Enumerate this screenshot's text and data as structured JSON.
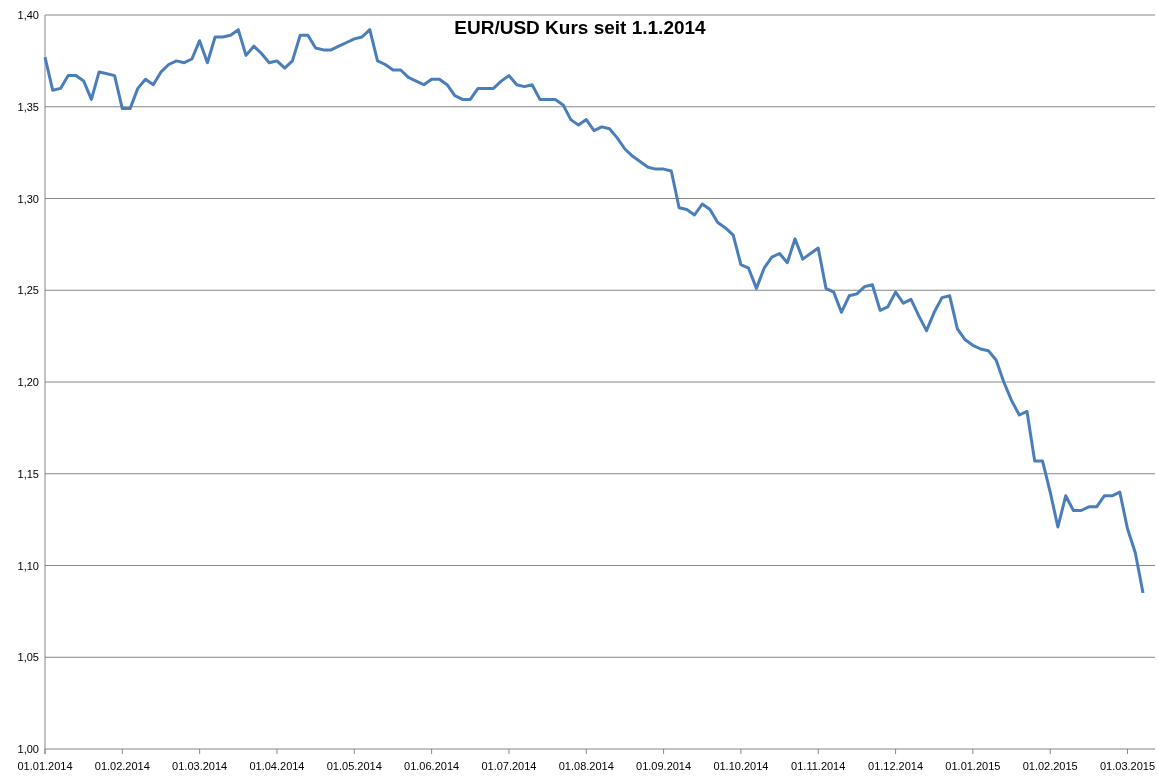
{
  "chart": {
    "chart_data": {
      "type": "line",
      "title": "EUR/USD Kurs seit 1.1.2014",
      "categories": [
        "01.01.2014",
        null,
        null,
        null,
        null,
        null,
        null,
        null,
        null,
        null,
        "01.02.2014",
        null,
        null,
        null,
        null,
        null,
        null,
        null,
        null,
        null,
        "01.03.2014",
        null,
        null,
        null,
        null,
        null,
        null,
        null,
        null,
        null,
        "01.04.2014",
        null,
        null,
        null,
        null,
        null,
        null,
        null,
        null,
        null,
        "01.05.2014",
        null,
        null,
        null,
        null,
        null,
        null,
        null,
        null,
        null,
        "01.06.2014",
        null,
        null,
        null,
        null,
        null,
        null,
        null,
        null,
        null,
        "01.07.2014",
        null,
        null,
        null,
        null,
        null,
        null,
        null,
        null,
        null,
        "01.08.2014",
        null,
        null,
        null,
        null,
        null,
        null,
        null,
        null,
        null,
        "01.09.2014",
        null,
        null,
        null,
        null,
        null,
        null,
        null,
        null,
        null,
        "01.10.2014",
        null,
        null,
        null,
        null,
        null,
        null,
        null,
        null,
        null,
        "01.11.2014",
        null,
        null,
        null,
        null,
        null,
        null,
        null,
        null,
        null,
        "01.12.2014",
        null,
        null,
        null,
        null,
        null,
        null,
        null,
        null,
        null,
        "01.01.2015",
        null,
        null,
        null,
        null,
        null,
        null,
        null,
        null,
        null,
        "01.02.2015",
        null,
        null,
        null,
        null,
        null,
        null,
        null,
        null,
        null,
        "01.03.2015",
        null,
        null
      ],
      "series": [
        {
          "color": "#4a7ebb",
          "values": [
            1.377,
            1.359,
            1.36,
            1.367,
            1.367,
            1.364,
            1.354,
            1.369,
            1.368,
            1.367,
            1.349,
            1.349,
            1.36,
            1.365,
            1.362,
            1.369,
            1.373,
            1.375,
            1.374,
            1.376,
            1.386,
            1.374,
            1.388,
            1.388,
            1.389,
            1.392,
            1.378,
            1.383,
            1.379,
            1.374,
            1.375,
            1.371,
            1.375,
            1.389,
            1.389,
            1.382,
            1.381,
            1.381,
            1.383,
            1.385,
            1.387,
            1.388,
            1.392,
            1.375,
            1.373,
            1.37,
            1.37,
            1.366,
            1.364,
            1.362,
            1.365,
            1.365,
            1.362,
            1.356,
            1.354,
            1.354,
            1.36,
            1.36,
            1.36,
            1.364,
            1.367,
            1.362,
            1.361,
            1.362,
            1.354,
            1.354,
            1.354,
            1.351,
            1.343,
            1.34,
            1.343,
            1.337,
            1.339,
            1.338,
            1.333,
            1.327,
            1.323,
            1.32,
            1.317,
            1.316,
            1.316,
            1.315,
            1.295,
            1.294,
            1.291,
            1.297,
            1.294,
            1.287,
            1.284,
            1.28,
            1.264,
            1.262,
            1.251,
            1.262,
            1.268,
            1.27,
            1.265,
            1.278,
            1.267,
            1.27,
            1.273,
            1.251,
            1.249,
            1.238,
            1.247,
            1.248,
            1.252,
            1.253,
            1.239,
            1.241,
            1.249,
            1.243,
            1.245,
            1.236,
            1.228,
            1.238,
            1.246,
            1.247,
            1.229,
            1.223,
            1.22,
            1.218,
            1.217,
            1.212,
            1.2,
            1.19,
            1.182,
            1.184,
            1.157,
            1.157,
            1.14,
            1.121,
            1.138,
            1.13,
            1.13,
            1.132,
            1.132,
            1.138,
            1.138,
            1.14,
            1.12,
            1.107,
            1.085
          ]
        }
      ],
      "ylim": [
        1.0,
        1.4
      ],
      "grid": true,
      "yticks": [
        {
          "value": 1.0,
          "label": "1,00"
        },
        {
          "value": 1.05,
          "label": "1,05"
        },
        {
          "value": 1.1,
          "label": "1,10"
        },
        {
          "value": 1.15,
          "label": "1,15"
        },
        {
          "value": 1.2,
          "label": "1,20"
        },
        {
          "value": 1.25,
          "label": "1,25"
        },
        {
          "value": 1.3,
          "label": "1,30"
        },
        {
          "value": 1.35,
          "label": "1,35"
        },
        {
          "value": 1.4,
          "label": "1,40"
        }
      ]
    }
  }
}
